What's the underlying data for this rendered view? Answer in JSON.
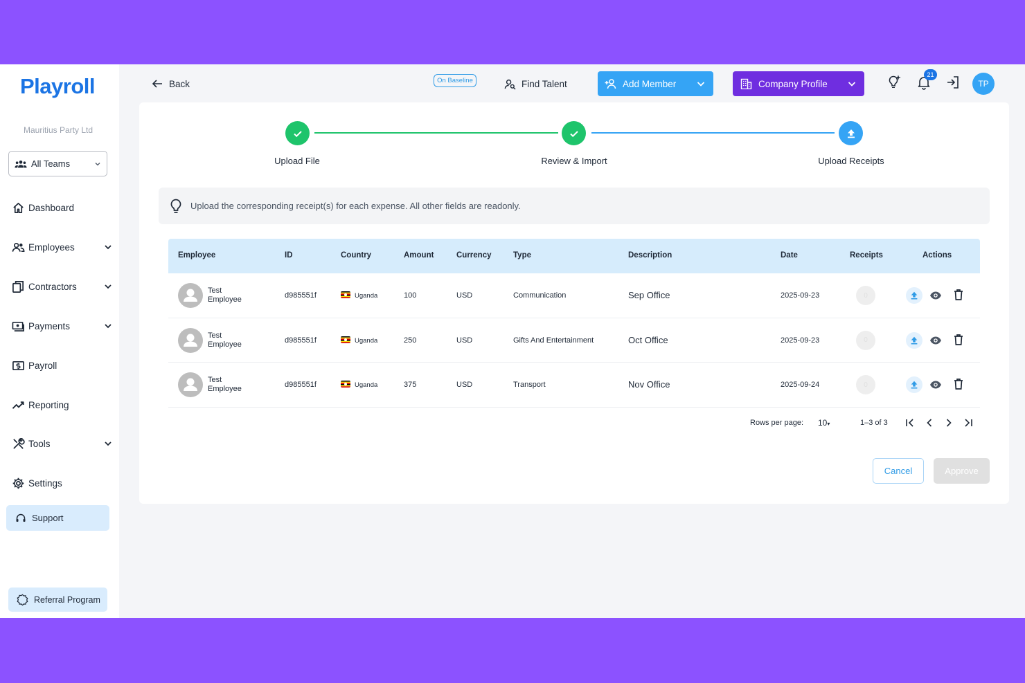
{
  "sidebar": {
    "logo": "Playroll",
    "org_name": "Mauritius Party Ltd",
    "team_select": "All Teams",
    "items": [
      {
        "label": "Dashboard"
      },
      {
        "label": "Employees"
      },
      {
        "label": "Contractors"
      },
      {
        "label": "Payments"
      },
      {
        "label": "Payroll"
      },
      {
        "label": "Reporting"
      },
      {
        "label": "Tools"
      },
      {
        "label": "Settings"
      }
    ],
    "support": "Support",
    "referral": "Referral Program"
  },
  "topbar": {
    "back": "Back",
    "baseline_badge": "On Baseline",
    "find_talent": "Find Talent",
    "add_member": "Add Member",
    "company_profile": "Company Profile",
    "notification_count": "21",
    "avatar_initials": "TP"
  },
  "stepper": {
    "steps": [
      {
        "label": "Upload File",
        "status": "complete"
      },
      {
        "label": "Review & Import",
        "status": "complete"
      },
      {
        "label": "Upload Receipts",
        "status": "current"
      }
    ]
  },
  "info": "Upload the corresponding receipt(s) for each expense. All other fields are readonly.",
  "table": {
    "headers": {
      "employee": "Employee",
      "id": "ID",
      "country": "Country",
      "amount": "Amount",
      "currency": "Currency",
      "type": "Type",
      "description": "Description",
      "date": "Date",
      "receipts": "Receipts",
      "actions": "Actions"
    },
    "rows": [
      {
        "name_first": "Test",
        "name_last": "Employee",
        "id": "d985551f",
        "country": "Uganda",
        "amount": "100",
        "currency": "USD",
        "type": "Communication",
        "description": "Sep Office",
        "date": "2025-09-23",
        "receipts": "0"
      },
      {
        "name_first": "Test",
        "name_last": "Employee",
        "id": "d985551f",
        "country": "Uganda",
        "amount": "250",
        "currency": "USD",
        "type": "Gifts And Entertainment",
        "description": "Oct Office",
        "date": "2025-09-23",
        "receipts": "0"
      },
      {
        "name_first": "Test",
        "name_last": "Employee",
        "id": "d985551f",
        "country": "Uganda",
        "amount": "375",
        "currency": "USD",
        "type": "Transport",
        "description": "Nov Office",
        "date": "2025-09-24",
        "receipts": "0"
      }
    ]
  },
  "pagination": {
    "rows_per_page_label": "Rows per page:",
    "rows_per_page": "10",
    "range": "1–3 of 3"
  },
  "actions": {
    "cancel": "Cancel",
    "approve": "Approve"
  },
  "colors": {
    "frame": "#8c52ff",
    "primary_blue": "#35a4f5",
    "company_purple": "#6f2ee0",
    "step_complete": "#1ec46b",
    "table_header": "#d6ecfc"
  }
}
